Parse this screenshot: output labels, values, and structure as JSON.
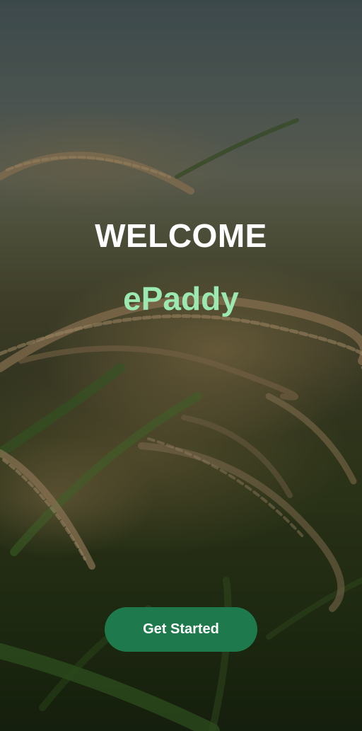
{
  "app": {
    "name": "ePaddy"
  },
  "welcome": {
    "heading": "WELCOME",
    "brand": "ePaddy"
  },
  "actions": {
    "get_started_label": "Get Started"
  },
  "theme": {
    "brand_text_color": "#9be8b0",
    "button_color": "#1e7a4c",
    "heading_color": "#ffffff"
  },
  "background": {
    "image": "rice-paddy-field-photo"
  }
}
